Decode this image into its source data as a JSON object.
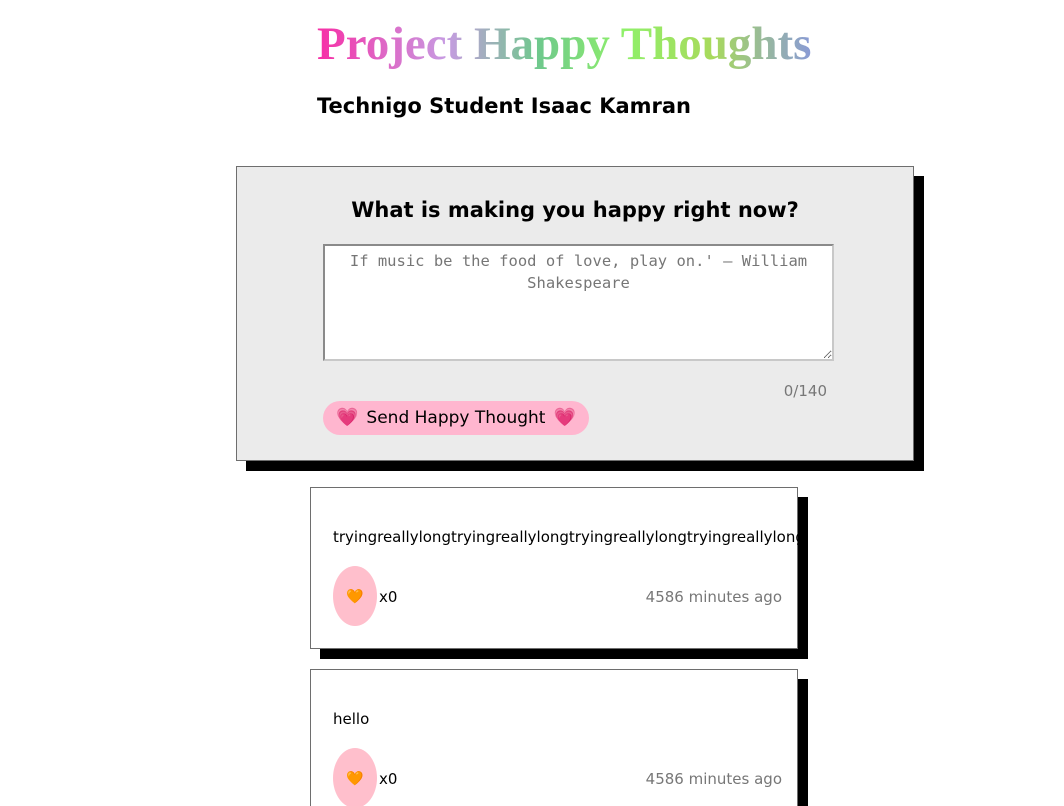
{
  "header": {
    "title": "Project Happy Thoughts",
    "subtitle": "Technigo Student Isaac Kamran"
  },
  "form": {
    "question": "What is making you happy right now?",
    "placeholder": "If music be the food of love, play on.' – William Shakespeare",
    "value": "",
    "counter": "0/140",
    "send_label": "Send Happy Thought",
    "send_icon_left": "💗",
    "send_icon_right": "💗"
  },
  "thoughts": [
    {
      "message": "tryingreallylongtryingreallylongtryingreallylongtryingreallylong",
      "heart_icon": "🧡",
      "likes": "x0",
      "time": "4586 minutes ago"
    },
    {
      "message": "hello",
      "heart_icon": "🧡",
      "likes": "x0",
      "time": "4586 minutes ago"
    }
  ],
  "colors": {
    "card_background": "#ebebeb",
    "button_pink": "#ffb6cf",
    "like_pink": "#ffbfcc",
    "shadow": "#000000"
  }
}
